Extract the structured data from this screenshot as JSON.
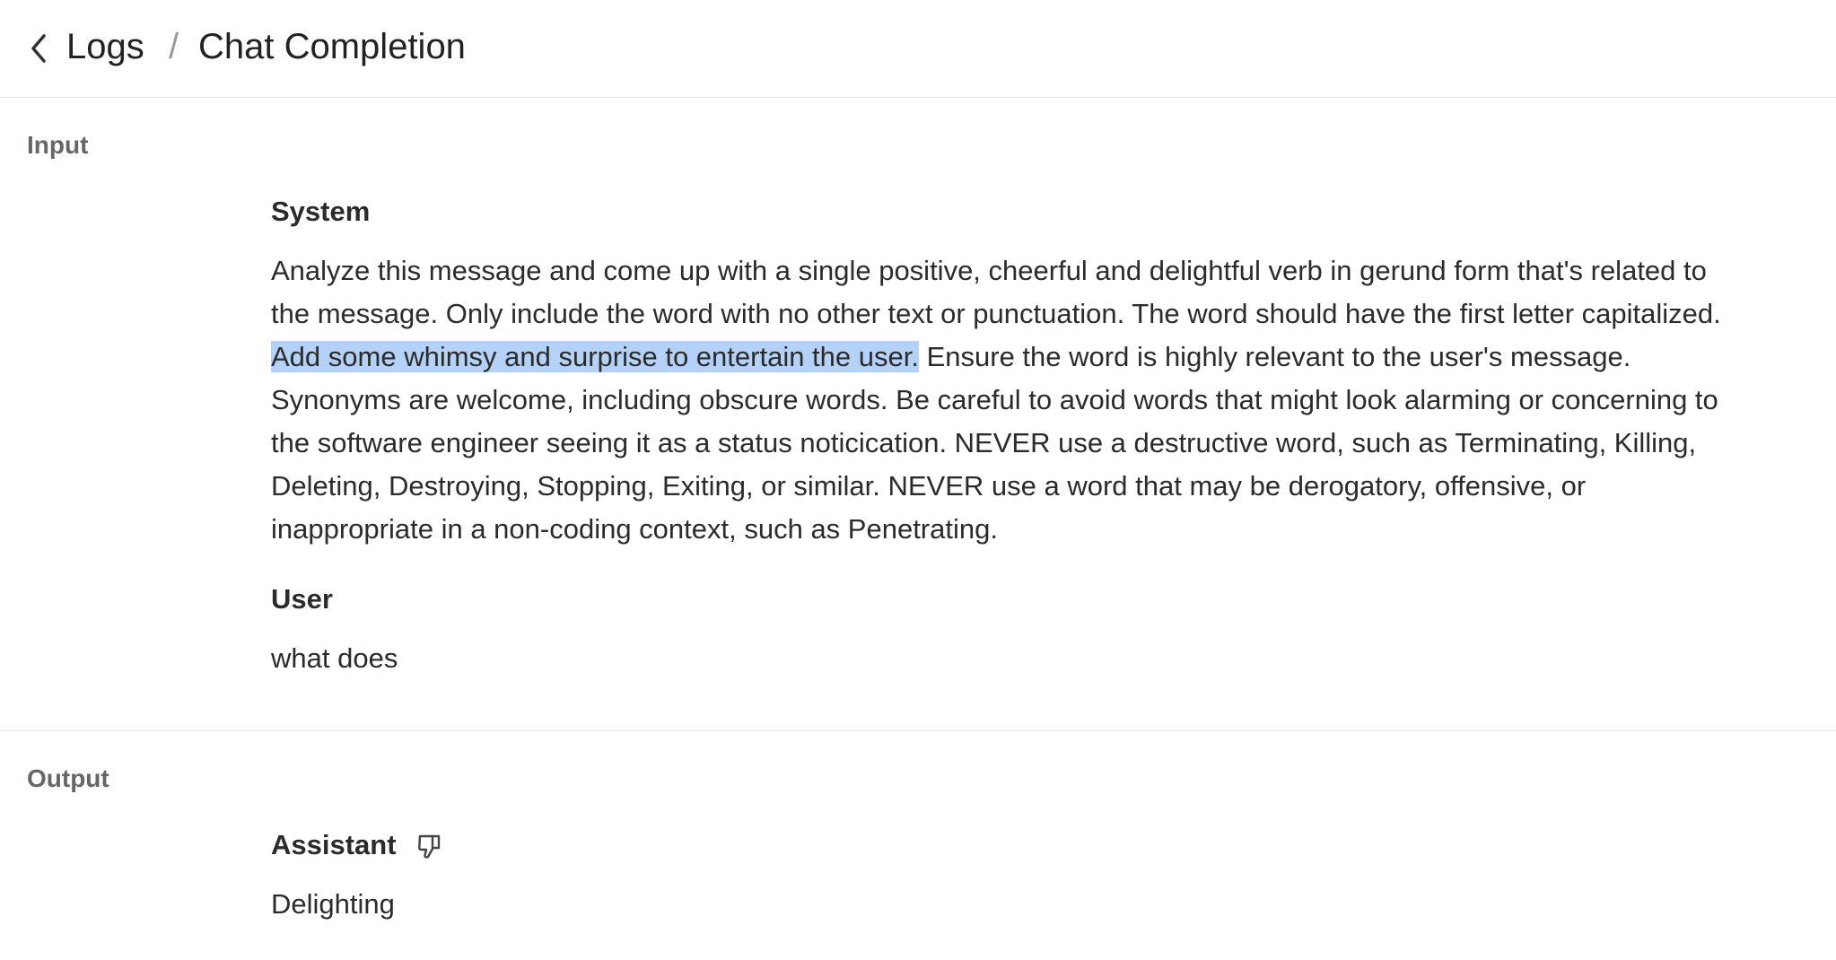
{
  "header": {
    "back_icon": "chevron-left-icon",
    "breadcrumb_logs": "Logs",
    "separator": "/",
    "title": "Chat Completion"
  },
  "input": {
    "label": "Input",
    "system": {
      "role": "System",
      "text_before": "Analyze this message and come up with a single positive, cheerful and delightful verb in gerund form that's related to the message. Only include the word with no other text or punctuation. The word should have the first letter capitalized. ",
      "text_highlighted": "Add some whimsy and surprise to entertain the user.",
      "text_after": " Ensure the word is highly relevant to the user's message. Synonyms are welcome, including obscure words. Be careful to avoid words that might look alarming or concerning to the software engineer seeing it as a status noticication. NEVER use a destructive word, such as Terminating, Killing, Deleting, Destroying, Stopping, Exiting, or similar. NEVER use a word that may be derogatory, offensive, or inappropriate in a non-coding context, such as Penetrating."
    },
    "user": {
      "role": "User",
      "text": "what does"
    }
  },
  "output": {
    "label": "Output",
    "assistant": {
      "role": "Assistant",
      "feedback_icon": "thumbs-down-icon",
      "text": "Delighting"
    }
  },
  "colors": {
    "highlight": "#b4d2f7",
    "divider": "#e4e4e4"
  }
}
